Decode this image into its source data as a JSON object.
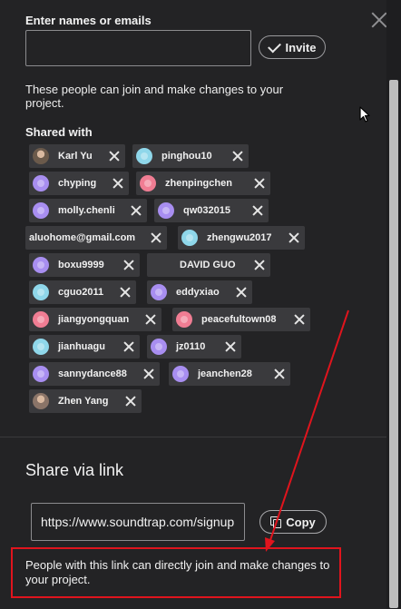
{
  "invite": {
    "label": "Enter names or emails",
    "input_value": "",
    "invite_button": "Invite",
    "description": "These people can join and make changes to your project."
  },
  "shared": {
    "label": "Shared with",
    "people": [
      {
        "name": "Karl Yu",
        "avatar": "photo",
        "color": "#6b5a4b"
      },
      {
        "name": "pinghou10",
        "avatar": "default",
        "color": "#8fd7ea"
      },
      {
        "name": "chyping",
        "avatar": "default",
        "color": "#a88ef0"
      },
      {
        "name": "zhenpingchen",
        "avatar": "default",
        "color": "#f07d93"
      },
      {
        "name": "molly.chenli",
        "avatar": "default",
        "color": "#a88ef0"
      },
      {
        "name": "qw032015",
        "avatar": "default",
        "color": "#a88ef0"
      },
      {
        "name": "aluohome@gmail.com",
        "avatar": "none",
        "color": ""
      },
      {
        "name": "zhengwu2017",
        "avatar": "default",
        "color": "#8fd7ea"
      },
      {
        "name": "boxu9999",
        "avatar": "default",
        "color": "#a88ef0"
      },
      {
        "name": "DAVID GUO",
        "avatar": "none",
        "color": ""
      },
      {
        "name": "cguo2011",
        "avatar": "default",
        "color": "#8fd7ea"
      },
      {
        "name": "eddyxiao",
        "avatar": "default",
        "color": "#a88ef0"
      },
      {
        "name": "jiangyongquan",
        "avatar": "default",
        "color": "#f07d93"
      },
      {
        "name": "peacefultown08",
        "avatar": "default",
        "color": "#f07d93"
      },
      {
        "name": "jianhuagu",
        "avatar": "default",
        "color": "#8fd7ea"
      },
      {
        "name": "jz0110",
        "avatar": "default",
        "color": "#a88ef0"
      },
      {
        "name": "sannydance88",
        "avatar": "default",
        "color": "#a88ef0"
      },
      {
        "name": "jeanchen28",
        "avatar": "default",
        "color": "#a88ef0"
      },
      {
        "name": "Zhen Yang",
        "avatar": "photo",
        "color": "#8a7468"
      }
    ]
  },
  "share_link": {
    "title": "Share via link",
    "url": "https://www.soundtrap.com/signup",
    "copy_button": "Copy",
    "description": "People with this link can directly join and make changes to your project."
  }
}
